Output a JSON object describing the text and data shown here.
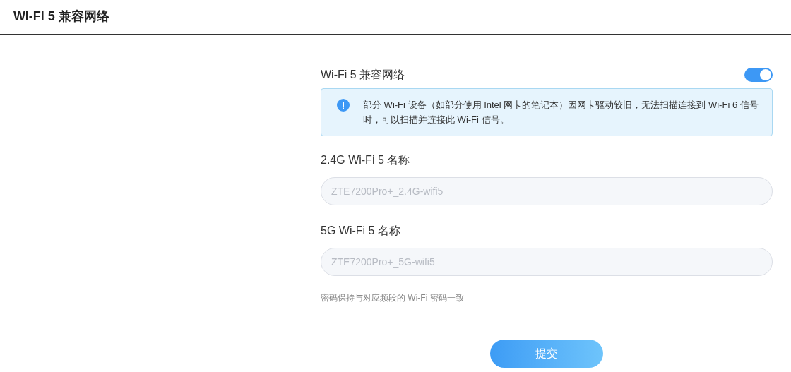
{
  "page_title": "Wi-Fi 5 兼容网络",
  "compat_toggle": {
    "label": "Wi-Fi 5 兼容网络",
    "on": true
  },
  "info_notice": "部分 Wi-Fi 设备（如部分使用 Intel 网卡的笔记本）因网卡驱动较旧，无法扫描连接到 Wi-Fi 6 信号时，可以扫描并连接此 Wi-Fi 信号。",
  "fields": [
    {
      "label": "2.4G Wi-Fi 5 名称",
      "value": "ZTE7200Pro+_2.4G-wifi5",
      "disabled": true
    },
    {
      "label": "5G Wi-Fi 5 名称",
      "value": "ZTE7200Pro+_5G-wifi5",
      "disabled": true
    }
  ],
  "hint": "密码保持与对应频段的 Wi-Fi 密码一致",
  "submit_button": "提交"
}
